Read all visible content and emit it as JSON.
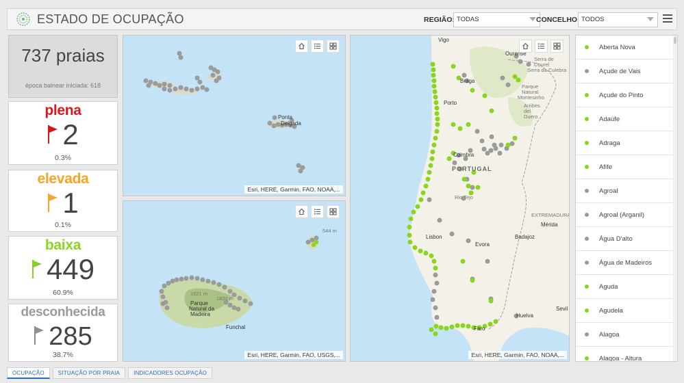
{
  "header": {
    "title": "ESTADO DE OCUPAÇÃO",
    "regiao_label": "REGIÃO:",
    "regiao_value": "TODAS",
    "concelho_label": "CONCELHO:",
    "concelho_value": "TODOS"
  },
  "summary": {
    "total": "737 praias",
    "season": "época balnear iniciada: 618"
  },
  "categories": [
    {
      "label": "plena",
      "count": "2",
      "pct": "0.3%",
      "color": "#e0161c",
      "flag_color": "#d8151a"
    },
    {
      "label": "elevada",
      "count": "1",
      "pct": "0.1%",
      "color": "#f5a522",
      "flag_color": "#f2a634"
    },
    {
      "label": "baixa",
      "count": "449",
      "pct": "60.9%",
      "color": "#8ad61f",
      "flag_color": "#86cf26"
    },
    {
      "label": "desconhecida",
      "count": "285",
      "pct": "38.7%",
      "color": "#9a9a9a",
      "flag_color": "#8f8f8f"
    }
  ],
  "maps": {
    "azores": {
      "attribution": "Esri, HERE, Garmin, FAO, NOAA,...",
      "labels": [
        "Ponta",
        "Delgada"
      ]
    },
    "madeira": {
      "attribution": "Esri, HERE, Garmin, FAO, USGS,...",
      "labels": [
        "1621 m",
        "1820 m",
        "Parque",
        "Natural da",
        "Madeira",
        "Funchal",
        "544 m"
      ]
    },
    "mainland": {
      "attribution": "Esri, HERE, Garmin, FAO, NOAA,...",
      "labels": [
        "Vigo",
        "Ourense",
        "Serra de",
        "Courel",
        "Serra da Culebra",
        "Braga",
        "Parque",
        "Natural",
        "Montesinho",
        "Porto",
        "Arribes",
        "del",
        "Duero",
        "Coimbra",
        "PORTUGAL",
        "Rio Tejo",
        "EXTREMADURA",
        "Mérida",
        "Lisbon",
        "Evora",
        "Badajoz",
        "Huelva",
        "Sevil",
        "Faro"
      ]
    }
  },
  "beaches": [
    {
      "name": "Aberta Nova",
      "status": "baixa"
    },
    {
      "name": "Açude de Vais",
      "status": "desconhecida"
    },
    {
      "name": "Açude do Pinto",
      "status": "baixa"
    },
    {
      "name": "Adaúfe",
      "status": "baixa"
    },
    {
      "name": "Adraga",
      "status": "baixa"
    },
    {
      "name": "Afife",
      "status": "baixa"
    },
    {
      "name": "Agroal",
      "status": "desconhecida"
    },
    {
      "name": "Agroal (Arganil)",
      "status": "desconhecida"
    },
    {
      "name": "Água D'alto",
      "status": "desconhecida"
    },
    {
      "name": "Água de Madeiros",
      "status": "desconhecida"
    },
    {
      "name": "Aguda",
      "status": "baixa"
    },
    {
      "name": "Agudela",
      "status": "baixa"
    },
    {
      "name": "Alagoa",
      "status": "desconhecida"
    },
    {
      "name": "Alagoa - Altura",
      "status": "baixa"
    }
  ],
  "status_colors": {
    "baixa": "#8ad61f",
    "desconhecida": "#9a9a9a"
  },
  "tabs": [
    "OCUPAÇÃO",
    "SITUAÇÃO POR PRAIA",
    "INDICADORES OCUPAÇÃO"
  ]
}
